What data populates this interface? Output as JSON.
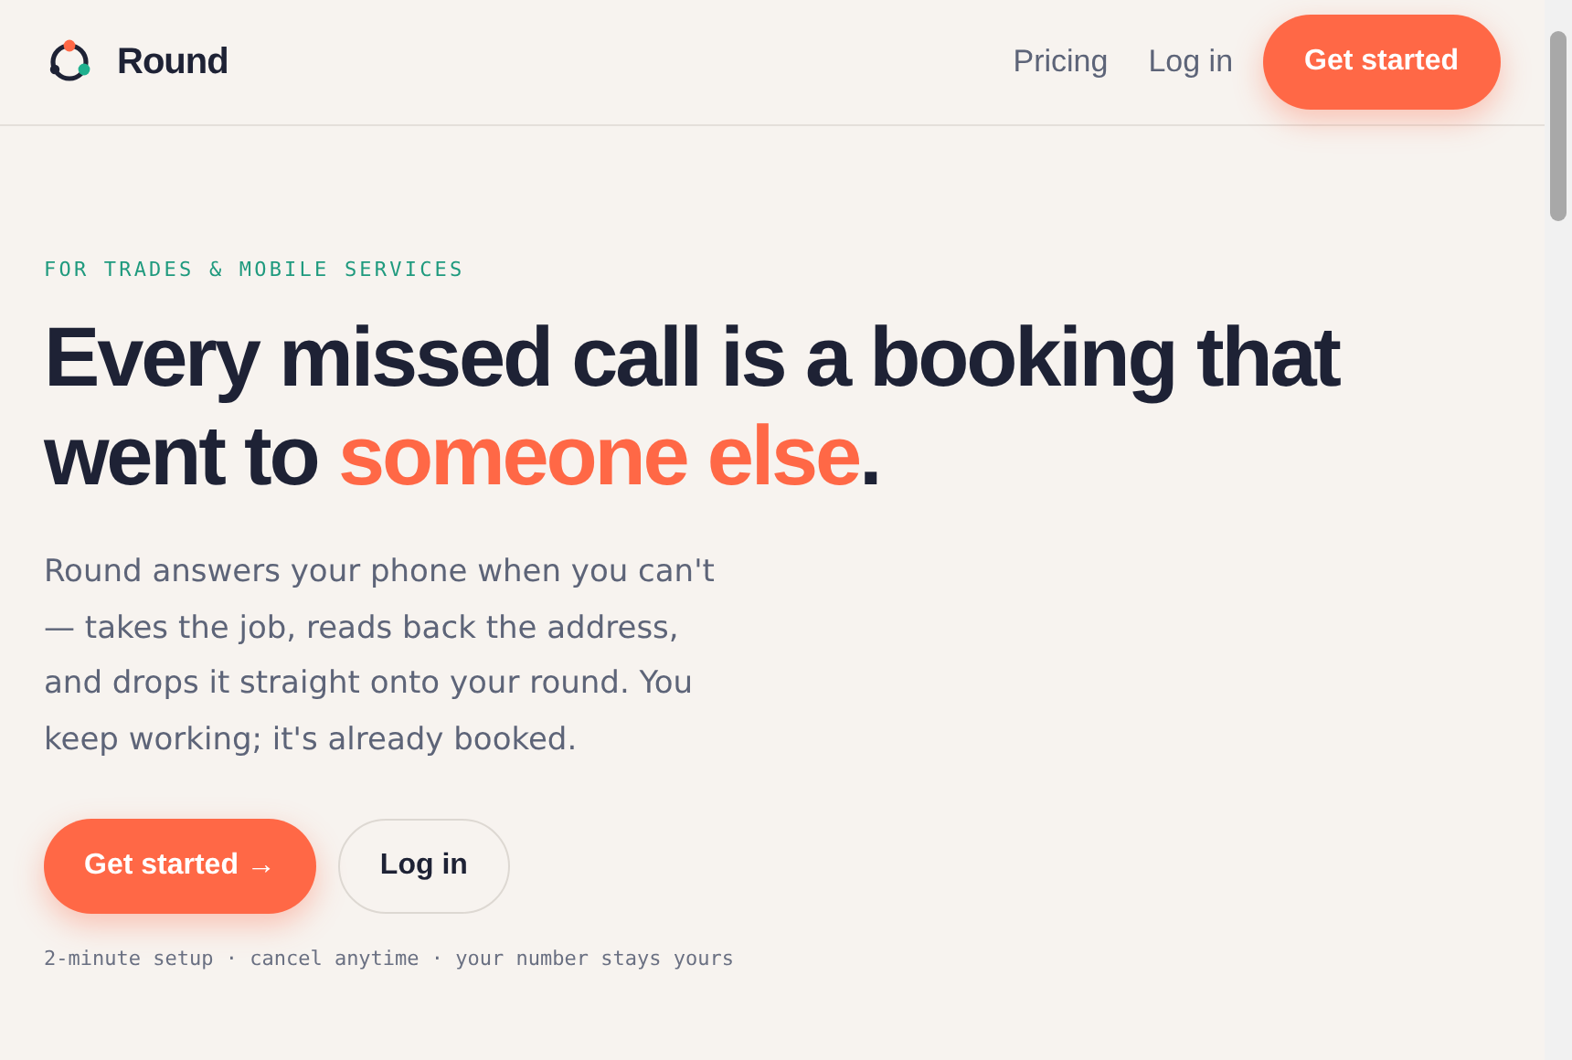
{
  "brand": {
    "name": "Round"
  },
  "nav": {
    "links": [
      "Pricing",
      "Log in"
    ],
    "cta": "Get started"
  },
  "hero": {
    "eyebrow": "FOR TRADES & MOBILE SERVICES",
    "headline": [
      {
        "text": "Every missed call is a booking that went to ",
        "kind": "plain"
      },
      {
        "text": "someone else",
        "kind": "accent"
      },
      {
        "text": ".",
        "kind": "plain"
      }
    ],
    "lede": "Round answers your phone when you can't — takes the job, reads back the address, and drops it straight onto your round. You keep working; it's already booked.",
    "buttons": [
      {
        "label": "Get started →",
        "kind": "primary"
      },
      {
        "label": "Log in",
        "kind": "secondary"
      }
    ],
    "note": "2-minute setup · cancel anytime · your number stays yours"
  }
}
